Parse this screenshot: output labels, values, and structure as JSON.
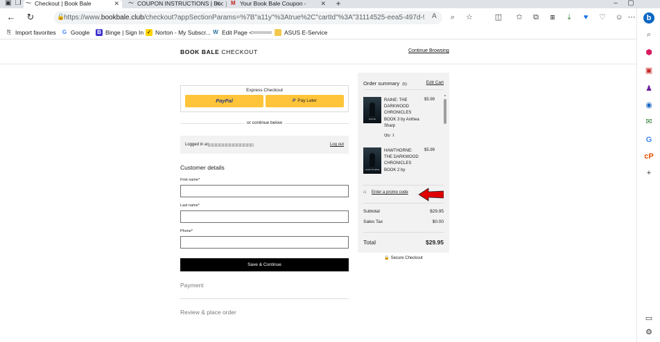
{
  "browser": {
    "tabs": [
      {
        "title": "Checkout | Book Bale",
        "active": true
      },
      {
        "title": "COUPON INSTRUCTIONS | Book",
        "active": false
      },
      {
        "title": "Your Book Bale Coupon - ",
        "active": false
      }
    ],
    "new_tab": "+",
    "url_scheme": "https://www.",
    "url_domain": "bookbale.club",
    "url_rest": "/checkout?appSectionParams=%7B\"a11y\"%3Atrue%2C\"cartId\"%3A\"31114525-eea5-497d-9c87-8b38469c7c...",
    "favorites": [
      {
        "label": "Import favorites",
        "icon": "import-icon"
      },
      {
        "label": "Google",
        "icon": "google-icon"
      },
      {
        "label": "Binge | Sign In",
        "icon": "binge-icon"
      },
      {
        "label": "Norton - My Subscr...",
        "icon": "norton-icon"
      },
      {
        "label": "Edit Page <",
        "icon": "wordpress-icon"
      },
      {
        "label": "ASUS E-Service",
        "icon": "folder-icon"
      }
    ]
  },
  "header": {
    "brand_bold": "BOOK BALE",
    "brand_rest": " CHECKOUT",
    "continue_label": "Continue Browsing"
  },
  "express": {
    "title": "Express Checkout",
    "paypal_label": "PayPal",
    "paylater_p": "P",
    "paylater_label": "Pay Later"
  },
  "or_continue": "or continue below",
  "account": {
    "logged_in_label": "Logged in as",
    "logout_label": "Log out"
  },
  "customer": {
    "title": "Customer details",
    "first_name_label": "First name*",
    "first_name_value": "",
    "last_name_label": "Last name*",
    "last_name_value": "",
    "phone_label": "Phone*",
    "phone_value": ""
  },
  "save_label": "Save & Continue",
  "payment_title": "Payment",
  "review_title": "Review & place order",
  "summary": {
    "title": "Order summary",
    "count": "(5)",
    "edit_cart": "Edit Cart",
    "items": [
      {
        "title": "RAINE: THE DARKWOOD CHRONICLES BOOK 3 by Anthea Sharp",
        "price": "$5.99",
        "qty": "Qty: 1",
        "cover_text": "RAINE"
      },
      {
        "title": "HAWTHORNE: THE DARKWOOD CHRONICLES BOOK 2 by",
        "price": "$5.99",
        "cover_text": "HAWTHORNE"
      }
    ],
    "promo_label": "Enter a promo code",
    "subtotal_label": "Subtotal",
    "subtotal_value": "$29.95",
    "tax_label": "Sales Tax",
    "tax_value": "$0.00",
    "total_label": "Total",
    "total_value": "$29.95",
    "secure_label": "Secure Checkout"
  },
  "colors": {
    "paypal_yellow": "#ffc439",
    "paypal_blue": "#253b80",
    "annotation_arrow": "#e00000",
    "edge_accent": "#0a66c2"
  }
}
